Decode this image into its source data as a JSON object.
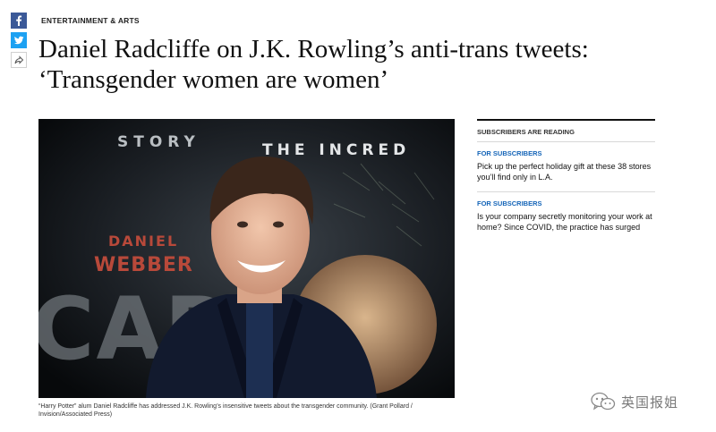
{
  "section_label": "ENTERTAINMENT & ARTS",
  "headline": {
    "line1": "Daniel Radcliffe on J.K. Rowling’s anti-trans tweets:",
    "line2": "‘Transgender women are women’"
  },
  "share": {
    "facebook_icon": "facebook-icon",
    "twitter_icon": "twitter-icon",
    "more_icon": "share-icon"
  },
  "photo": {
    "background_text_top_left": "STORY",
    "background_text_top_right": "THE INCRED",
    "background_name_1": "DANIEL",
    "background_name_2": "WEBBER",
    "background_big_text": "CAPE"
  },
  "caption": "“Harry Potter” alum Daniel Radcliffe has addressed J.K. Rowling’s insensitive tweets about the transgender community. (Grant Pollard / Invision/Associated Press)",
  "sidebar": {
    "title": "SUBSCRIBERS ARE READING",
    "items": [
      {
        "label": "FOR SUBSCRIBERS",
        "text": "Pick up the perfect holiday gift at these 38 stores you’ll find only in L.A."
      },
      {
        "label": "FOR SUBSCRIBERS",
        "text": "Is your company secretly monitoring your work at home? Since COVID, the practice has surged"
      }
    ]
  },
  "watermark": {
    "text": "英国报姐",
    "icon": "wechat-icon"
  },
  "colors": {
    "facebook": "#3b5998",
    "twitter": "#1da1f2",
    "subscriber_label": "#1565b8",
    "photo_text_red": "#b8493a"
  }
}
